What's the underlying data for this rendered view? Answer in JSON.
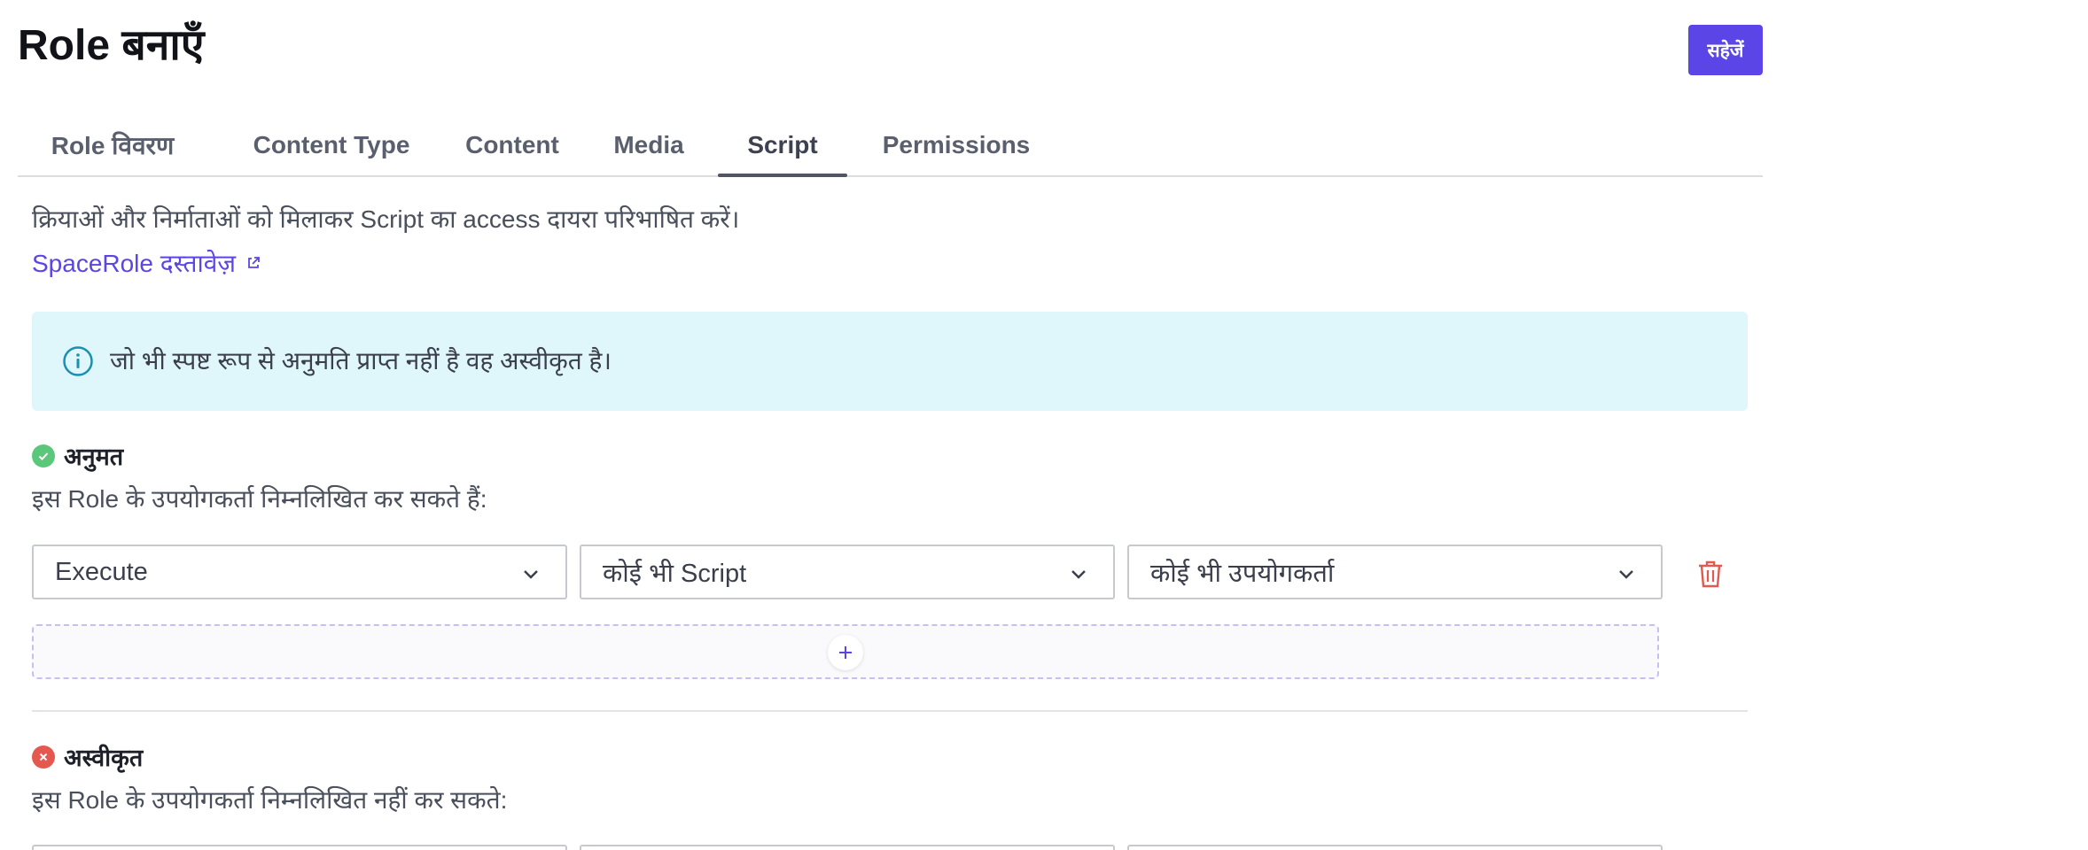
{
  "header": {
    "title": "Role बनाएँ",
    "save_label": "सहेजें"
  },
  "tabs": [
    {
      "label": "Role विवरण",
      "active": false
    },
    {
      "label": "Content Type",
      "active": false
    },
    {
      "label": "Content",
      "active": false
    },
    {
      "label": "Media",
      "active": false
    },
    {
      "label": "Script",
      "active": true
    },
    {
      "label": "Permissions",
      "active": false
    }
  ],
  "intro": {
    "description": "क्रियाओं और निर्माताओं को मिलाकर Script का access दायरा परिभाषित करें।",
    "doc_link_label": "SpaceRole दस्तावेज़"
  },
  "info_banner": {
    "icon": "info-icon",
    "text": "जो भी स्पष्ट रूप से अनुमति प्राप्त नहीं है वह अस्वीकृत है।"
  },
  "allowed": {
    "heading": "अनुमत",
    "subtext": "इस Role के उपयोगकर्ता निम्नलिखित कर सकते हैं:",
    "status_color": "#5bc77a",
    "rule": {
      "action": "Execute",
      "entity": "कोई भी Script",
      "creator": "कोई भी उपयोगकर्ता"
    }
  },
  "denied": {
    "heading": "अस्वीकृत",
    "subtext": "इस Role के उपयोगकर्ता निम्नलिखित नहीं कर सकते:",
    "status_color": "#e5584f"
  },
  "colors": {
    "accent": "#5b45e6",
    "info_bg": "#dff6fb",
    "delete": "#e05a4f"
  }
}
